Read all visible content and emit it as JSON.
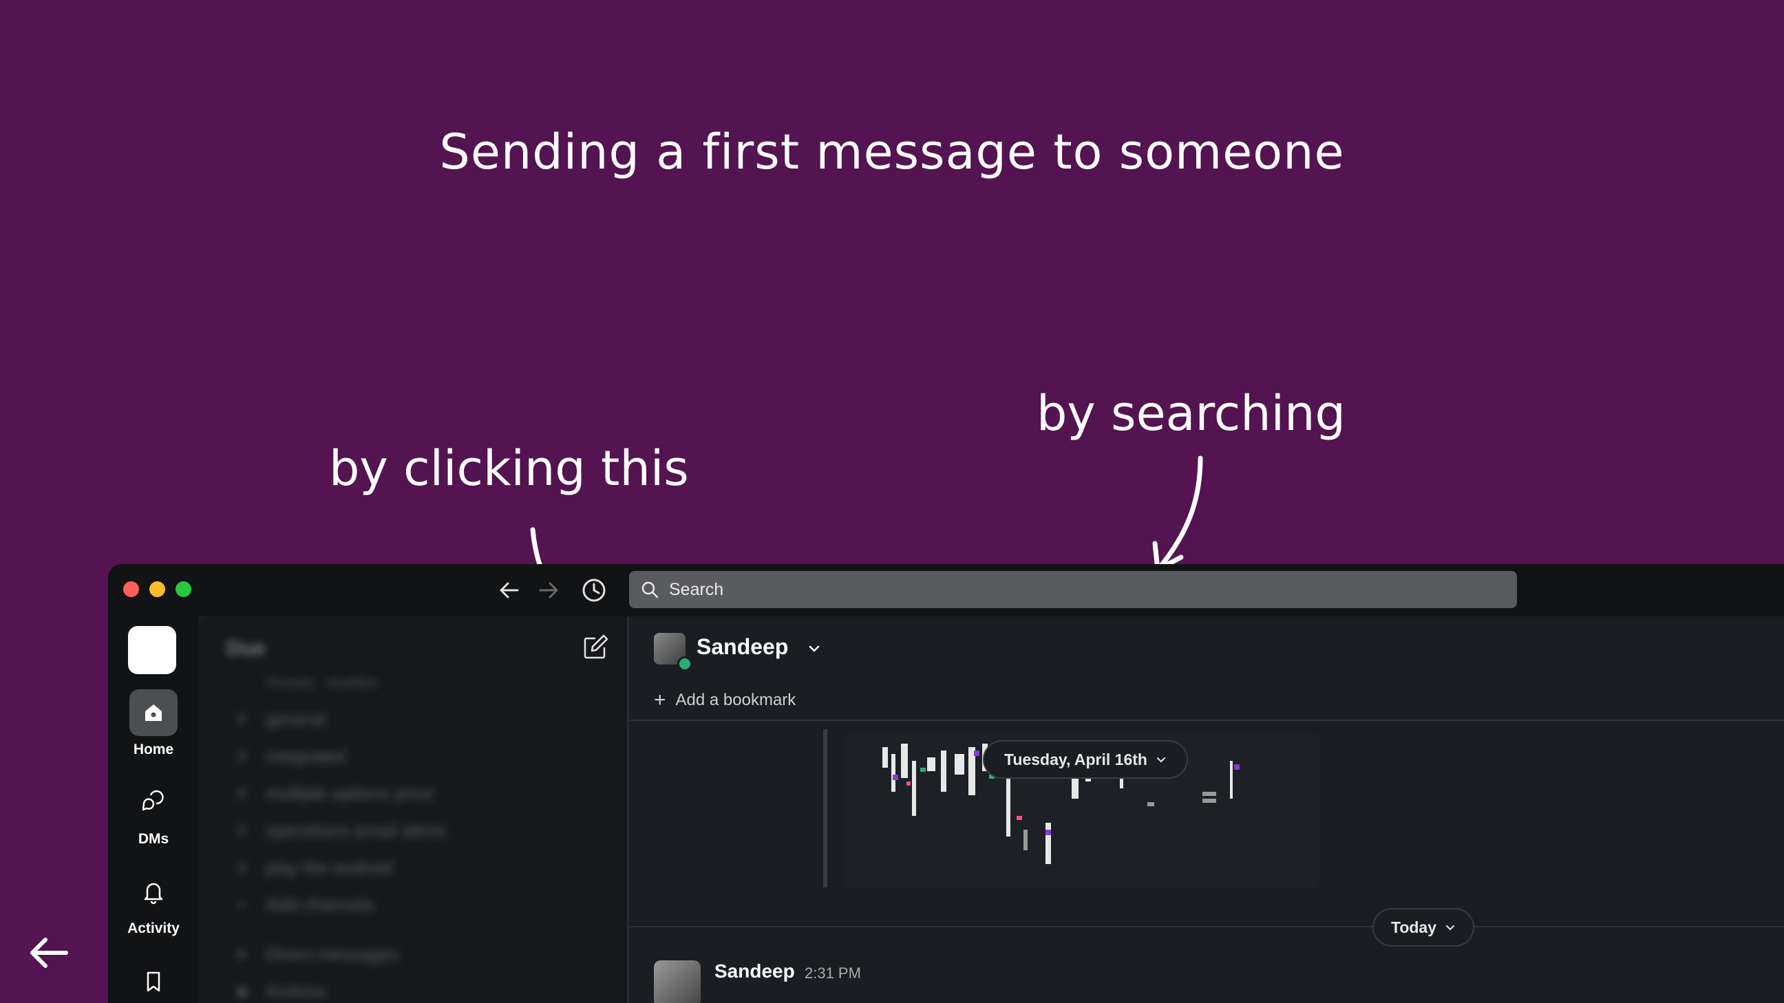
{
  "slide": {
    "title": "Sending a first message to someone",
    "annotation_click": "by clicking this",
    "annotation_search": "by searching"
  },
  "window": {
    "search_placeholder": "Search"
  },
  "rail": {
    "items": [
      {
        "label": "Home",
        "icon": "home-icon",
        "active": true
      },
      {
        "label": "DMs",
        "icon": "dms-icon",
        "active": false
      },
      {
        "label": "Activity",
        "icon": "bell-icon",
        "active": false
      }
    ]
  },
  "sidebar": {
    "workspace": "Due",
    "subtitle": "Threads · Huddles",
    "channels": [
      "general",
      "integrated",
      "multiple options price",
      "operations email alerts",
      "play the android",
      "Add channels"
    ],
    "section": "Direct messages",
    "dm": "Andrew"
  },
  "channel": {
    "name": "Sandeep",
    "add_bookmark": "Add a bookmark",
    "date_divider": "Tuesday, April 16th",
    "today_divider": "Today",
    "colors": {
      "presence": "#2bac76",
      "background": "#541351"
    }
  },
  "message": {
    "author": "Sandeep",
    "time": "2:31 PM"
  }
}
